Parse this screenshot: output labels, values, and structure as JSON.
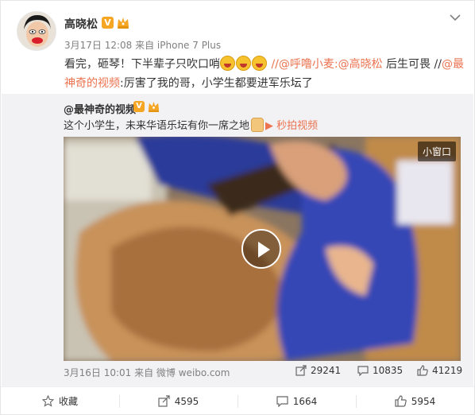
{
  "post": {
    "author": "高晓松",
    "timestamp": "3月17日 12:08 来自 iPhone 7 Plus",
    "text_parts": {
      "p1": "看完，砸琴！下半辈子只吹口哨",
      "p2": " //",
      "link1": "@呼噜小麦",
      "p3": ":",
      "link2": "@高晓松",
      "p4": " 后生可畏 //",
      "link3": "@最神奇的视频",
      "p5": ":厉害了我的哥，小学生都要进军乐坛了"
    }
  },
  "repost": {
    "author": "@最神奇的视频",
    "text": "这个小学生，未来华语乐坛有你一席之地",
    "camera_link": "秒拍视频",
    "video_button": "小窗口",
    "date": "3月16日 10:01 来自 微博 weibo.com",
    "stats": {
      "reposts": "29241",
      "comments": "10835",
      "likes": "41219"
    }
  },
  "actions": {
    "favorite": "收藏",
    "repost": "4595",
    "comment": "1664",
    "like": "5954"
  },
  "icons": {
    "verified": "V",
    "colors": {
      "accent": "#eb7350",
      "badge": "#f5a623"
    }
  }
}
